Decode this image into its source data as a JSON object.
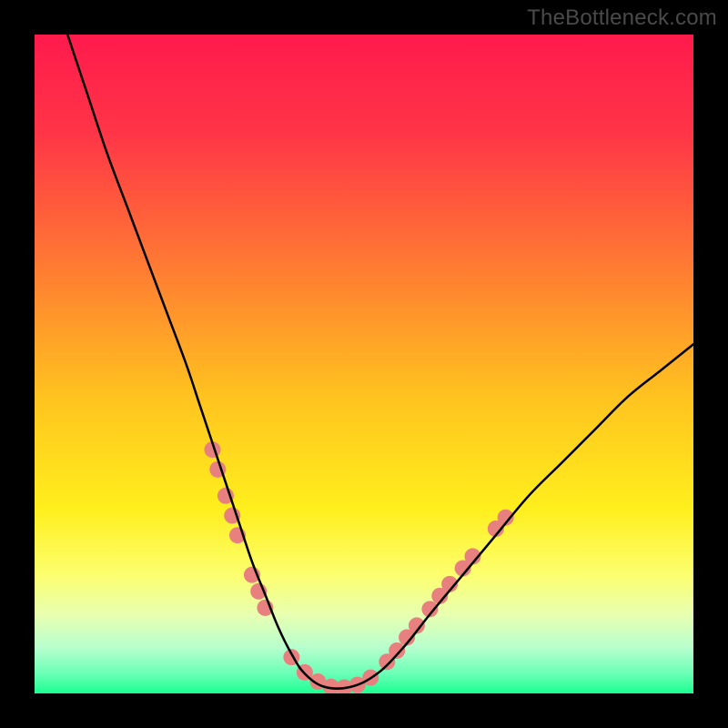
{
  "watermark": "TheBottleneck.com",
  "chart_data": {
    "type": "line",
    "title": "",
    "xlabel": "",
    "ylabel": "",
    "xlim": [
      0,
      100
    ],
    "ylim": [
      0,
      100
    ],
    "background_gradient": {
      "stops": [
        {
          "offset": 0.0,
          "color": "#ff1a4c"
        },
        {
          "offset": 0.15,
          "color": "#ff3547"
        },
        {
          "offset": 0.35,
          "color": "#ff7a33"
        },
        {
          "offset": 0.55,
          "color": "#ffc31f"
        },
        {
          "offset": 0.72,
          "color": "#ffef1d"
        },
        {
          "offset": 0.82,
          "color": "#fcff6e"
        },
        {
          "offset": 0.88,
          "color": "#e8ffb0"
        },
        {
          "offset": 0.93,
          "color": "#b8ffce"
        },
        {
          "offset": 0.97,
          "color": "#6affb6"
        },
        {
          "offset": 1.0,
          "color": "#1aff91"
        }
      ]
    },
    "series": [
      {
        "name": "bottleneck-curve",
        "color": "#000000",
        "x": [
          5,
          8,
          11,
          14,
          17,
          20,
          23,
          25,
          27,
          29,
          31,
          33,
          35,
          37,
          39,
          41,
          44,
          48,
          52,
          56,
          60,
          65,
          70,
          75,
          80,
          85,
          90,
          95,
          100
        ],
        "y": [
          100,
          91,
          82,
          74,
          66,
          58,
          50,
          44,
          38,
          32,
          26,
          20,
          15,
          10,
          6,
          3,
          1,
          1,
          3,
          7,
          12,
          18,
          24,
          30,
          35,
          40,
          45,
          49,
          53
        ]
      }
    ],
    "marker_clusters": [
      {
        "name": "left-cluster",
        "color": "#e98080",
        "radius": 9,
        "points": [
          {
            "x": 27.0,
            "y": 37
          },
          {
            "x": 27.8,
            "y": 34
          },
          {
            "x": 29.0,
            "y": 30
          },
          {
            "x": 30.0,
            "y": 27
          },
          {
            "x": 30.8,
            "y": 24
          },
          {
            "x": 33.0,
            "y": 18
          },
          {
            "x": 34.0,
            "y": 15.5
          },
          {
            "x": 35.0,
            "y": 13
          }
        ]
      },
      {
        "name": "bottom-cluster",
        "color": "#e98080",
        "radius": 9,
        "points": [
          {
            "x": 39,
            "y": 5.5
          },
          {
            "x": 41,
            "y": 3.2
          },
          {
            "x": 43,
            "y": 1.8
          },
          {
            "x": 45,
            "y": 1.0
          },
          {
            "x": 47,
            "y": 0.9
          },
          {
            "x": 49,
            "y": 1.3
          },
          {
            "x": 51,
            "y": 2.4
          }
        ]
      },
      {
        "name": "right-cluster",
        "color": "#e98080",
        "radius": 9,
        "points": [
          {
            "x": 53.5,
            "y": 4.8
          },
          {
            "x": 55.0,
            "y": 6.5
          },
          {
            "x": 56.5,
            "y": 8.5
          },
          {
            "x": 58.0,
            "y": 10.3
          },
          {
            "x": 60.0,
            "y": 12.8
          },
          {
            "x": 61.5,
            "y": 14.8
          },
          {
            "x": 63.0,
            "y": 16.6
          },
          {
            "x": 65.0,
            "y": 19.0
          },
          {
            "x": 66.5,
            "y": 20.8
          },
          {
            "x": 70.0,
            "y": 25.0
          },
          {
            "x": 71.5,
            "y": 26.7
          }
        ]
      }
    ]
  }
}
